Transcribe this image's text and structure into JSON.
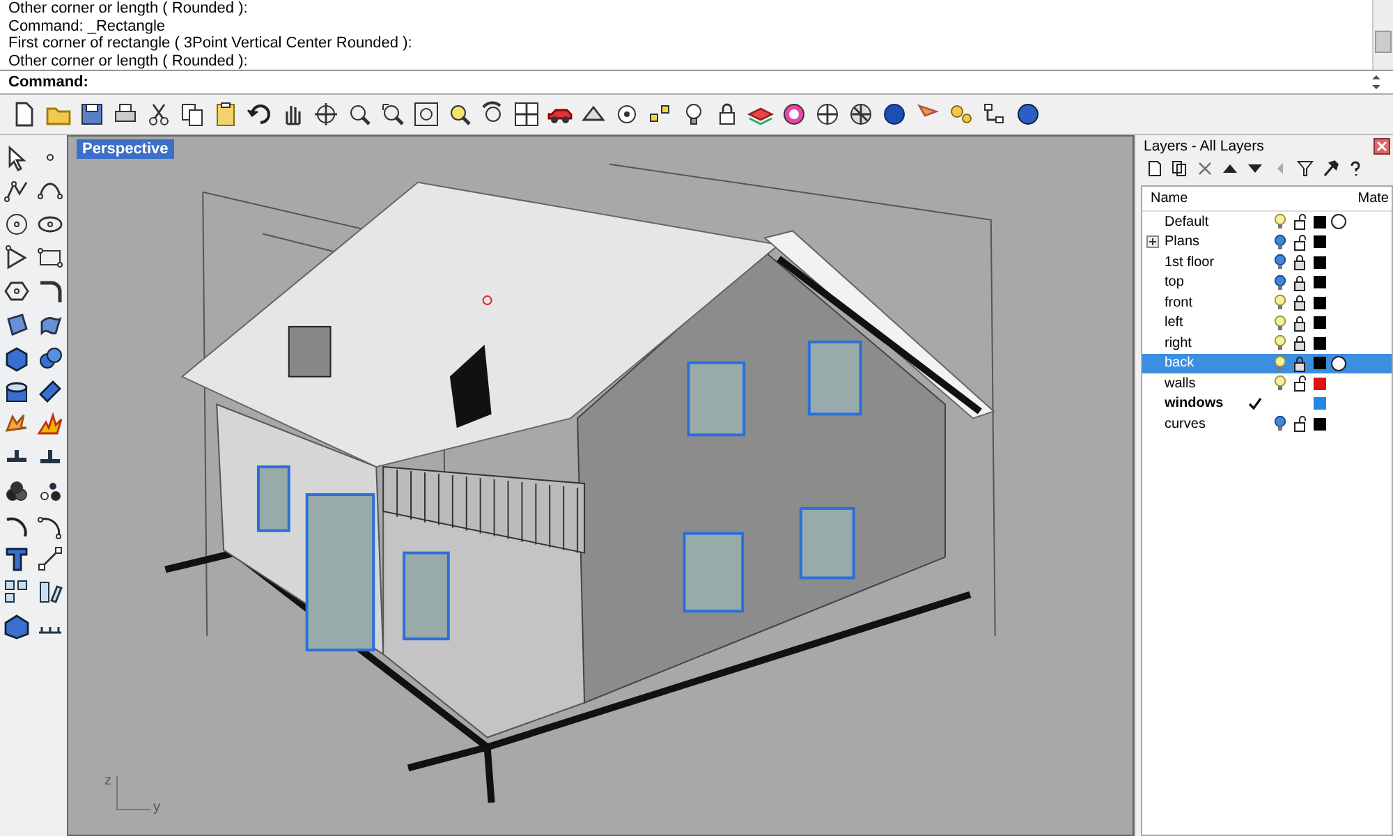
{
  "command_history": [
    "Other corner or length ( Rounded ):",
    "Command: _Rectangle",
    "First corner of rectangle ( 3Point  Vertical  Center  Rounded ):",
    "Other corner or length ( Rounded ):"
  ],
  "command_prompt": "Command:",
  "viewport": {
    "title": "Perspective",
    "axis_labels": [
      "z",
      "y"
    ]
  },
  "layers_panel": {
    "title": "Layers - All Layers",
    "columns": [
      "Name",
      "Mate"
    ],
    "layers": [
      {
        "name": "Default",
        "visible": true,
        "locked": false,
        "color": "#000000",
        "material": true,
        "current": false,
        "selected": false
      },
      {
        "name": "Plans",
        "visible": false,
        "locked": false,
        "color": "#000000",
        "material": false,
        "current": false,
        "selected": false,
        "expanded": false
      },
      {
        "name": "1st floor",
        "visible": false,
        "locked": true,
        "color": "#000000",
        "material": false,
        "current": false,
        "selected": false
      },
      {
        "name": "top",
        "visible": false,
        "locked": true,
        "color": "#000000",
        "material": false,
        "current": false,
        "selected": false
      },
      {
        "name": "front",
        "visible": true,
        "locked": true,
        "color": "#000000",
        "material": false,
        "current": false,
        "selected": false
      },
      {
        "name": "left",
        "visible": true,
        "locked": true,
        "color": "#000000",
        "material": false,
        "current": false,
        "selected": false
      },
      {
        "name": "right",
        "visible": true,
        "locked": true,
        "color": "#000000",
        "material": false,
        "current": false,
        "selected": false
      },
      {
        "name": "back",
        "visible": true,
        "locked": true,
        "color": "#000000",
        "material": true,
        "current": false,
        "selected": true
      },
      {
        "name": "walls",
        "visible": true,
        "locked": false,
        "color": "#e01010",
        "material": false,
        "current": false,
        "selected": false
      },
      {
        "name": "windows",
        "color": "#1e88e5",
        "current": true,
        "selected": false
      },
      {
        "name": "curves",
        "visible": false,
        "locked": false,
        "color": "#000000",
        "material": false,
        "current": false,
        "selected": false
      }
    ]
  }
}
